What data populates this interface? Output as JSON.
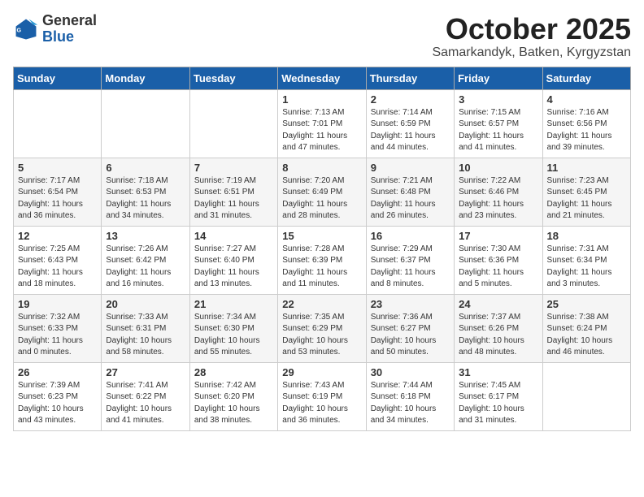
{
  "header": {
    "logo_general": "General",
    "logo_blue": "Blue",
    "month_title": "October 2025",
    "location": "Samarkandyk, Batken, Kyrgyzstan"
  },
  "weekdays": [
    "Sunday",
    "Monday",
    "Tuesday",
    "Wednesday",
    "Thursday",
    "Friday",
    "Saturday"
  ],
  "weeks": [
    [
      {
        "day": "",
        "info": ""
      },
      {
        "day": "",
        "info": ""
      },
      {
        "day": "",
        "info": ""
      },
      {
        "day": "1",
        "info": "Sunrise: 7:13 AM\nSunset: 7:01 PM\nDaylight: 11 hours and 47 minutes."
      },
      {
        "day": "2",
        "info": "Sunrise: 7:14 AM\nSunset: 6:59 PM\nDaylight: 11 hours and 44 minutes."
      },
      {
        "day": "3",
        "info": "Sunrise: 7:15 AM\nSunset: 6:57 PM\nDaylight: 11 hours and 41 minutes."
      },
      {
        "day": "4",
        "info": "Sunrise: 7:16 AM\nSunset: 6:56 PM\nDaylight: 11 hours and 39 minutes."
      }
    ],
    [
      {
        "day": "5",
        "info": "Sunrise: 7:17 AM\nSunset: 6:54 PM\nDaylight: 11 hours and 36 minutes."
      },
      {
        "day": "6",
        "info": "Sunrise: 7:18 AM\nSunset: 6:53 PM\nDaylight: 11 hours and 34 minutes."
      },
      {
        "day": "7",
        "info": "Sunrise: 7:19 AM\nSunset: 6:51 PM\nDaylight: 11 hours and 31 minutes."
      },
      {
        "day": "8",
        "info": "Sunrise: 7:20 AM\nSunset: 6:49 PM\nDaylight: 11 hours and 28 minutes."
      },
      {
        "day": "9",
        "info": "Sunrise: 7:21 AM\nSunset: 6:48 PM\nDaylight: 11 hours and 26 minutes."
      },
      {
        "day": "10",
        "info": "Sunrise: 7:22 AM\nSunset: 6:46 PM\nDaylight: 11 hours and 23 minutes."
      },
      {
        "day": "11",
        "info": "Sunrise: 7:23 AM\nSunset: 6:45 PM\nDaylight: 11 hours and 21 minutes."
      }
    ],
    [
      {
        "day": "12",
        "info": "Sunrise: 7:25 AM\nSunset: 6:43 PM\nDaylight: 11 hours and 18 minutes."
      },
      {
        "day": "13",
        "info": "Sunrise: 7:26 AM\nSunset: 6:42 PM\nDaylight: 11 hours and 16 minutes."
      },
      {
        "day": "14",
        "info": "Sunrise: 7:27 AM\nSunset: 6:40 PM\nDaylight: 11 hours and 13 minutes."
      },
      {
        "day": "15",
        "info": "Sunrise: 7:28 AM\nSunset: 6:39 PM\nDaylight: 11 hours and 11 minutes."
      },
      {
        "day": "16",
        "info": "Sunrise: 7:29 AM\nSunset: 6:37 PM\nDaylight: 11 hours and 8 minutes."
      },
      {
        "day": "17",
        "info": "Sunrise: 7:30 AM\nSunset: 6:36 PM\nDaylight: 11 hours and 5 minutes."
      },
      {
        "day": "18",
        "info": "Sunrise: 7:31 AM\nSunset: 6:34 PM\nDaylight: 11 hours and 3 minutes."
      }
    ],
    [
      {
        "day": "19",
        "info": "Sunrise: 7:32 AM\nSunset: 6:33 PM\nDaylight: 11 hours and 0 minutes."
      },
      {
        "day": "20",
        "info": "Sunrise: 7:33 AM\nSunset: 6:31 PM\nDaylight: 10 hours and 58 minutes."
      },
      {
        "day": "21",
        "info": "Sunrise: 7:34 AM\nSunset: 6:30 PM\nDaylight: 10 hours and 55 minutes."
      },
      {
        "day": "22",
        "info": "Sunrise: 7:35 AM\nSunset: 6:29 PM\nDaylight: 10 hours and 53 minutes."
      },
      {
        "day": "23",
        "info": "Sunrise: 7:36 AM\nSunset: 6:27 PM\nDaylight: 10 hours and 50 minutes."
      },
      {
        "day": "24",
        "info": "Sunrise: 7:37 AM\nSunset: 6:26 PM\nDaylight: 10 hours and 48 minutes."
      },
      {
        "day": "25",
        "info": "Sunrise: 7:38 AM\nSunset: 6:24 PM\nDaylight: 10 hours and 46 minutes."
      }
    ],
    [
      {
        "day": "26",
        "info": "Sunrise: 7:39 AM\nSunset: 6:23 PM\nDaylight: 10 hours and 43 minutes."
      },
      {
        "day": "27",
        "info": "Sunrise: 7:41 AM\nSunset: 6:22 PM\nDaylight: 10 hours and 41 minutes."
      },
      {
        "day": "28",
        "info": "Sunrise: 7:42 AM\nSunset: 6:20 PM\nDaylight: 10 hours and 38 minutes."
      },
      {
        "day": "29",
        "info": "Sunrise: 7:43 AM\nSunset: 6:19 PM\nDaylight: 10 hours and 36 minutes."
      },
      {
        "day": "30",
        "info": "Sunrise: 7:44 AM\nSunset: 6:18 PM\nDaylight: 10 hours and 34 minutes."
      },
      {
        "day": "31",
        "info": "Sunrise: 7:45 AM\nSunset: 6:17 PM\nDaylight: 10 hours and 31 minutes."
      },
      {
        "day": "",
        "info": ""
      }
    ]
  ]
}
